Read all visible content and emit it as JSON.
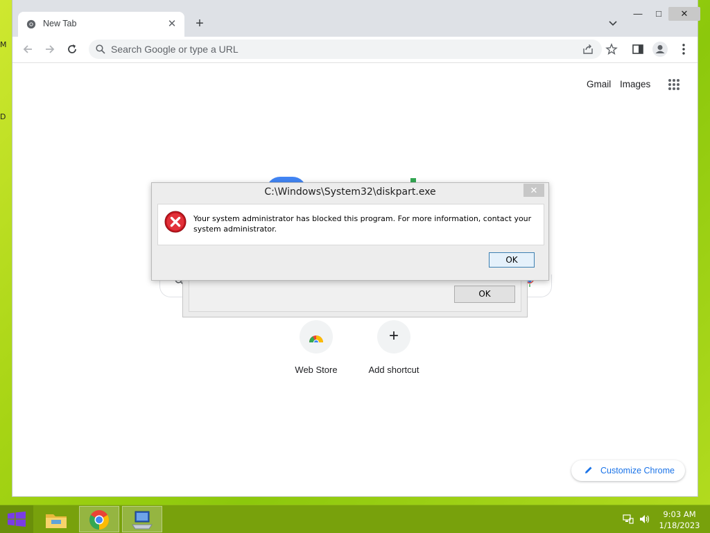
{
  "desktop": {
    "edge_letters": [
      "M",
      "D"
    ]
  },
  "browser": {
    "tab_title": "New Tab",
    "omnibox_placeholder": "Search Google or type a URL",
    "window_controls": {
      "minimize": "—",
      "maximize": "□",
      "close": "✕"
    }
  },
  "ntp": {
    "top_links": [
      "Gmail",
      "Images"
    ],
    "shortcuts": [
      {
        "label": "Web Store",
        "icon": "chrome-web-store-icon"
      },
      {
        "label": "Add shortcut",
        "icon": "plus-icon"
      }
    ],
    "customize_label": "Customize Chrome"
  },
  "back_dialog": {
    "ok_label": "OK"
  },
  "dialog": {
    "title": "C:\\Windows\\System32\\diskpart.exe",
    "message": "Your system administrator has blocked this program. For more information, contact your system administrator.",
    "ok_label": "OK",
    "close_glyph": "✕",
    "icon": "error-icon"
  },
  "taskbar": {
    "apps": [
      "start-icon",
      "file-explorer-icon",
      "chrome-icon",
      "remote-desktop-icon"
    ],
    "clock": {
      "time": "9:03 AM",
      "date": "1/18/2023"
    }
  },
  "colors": {
    "accent_blue": "#1a73e8",
    "taskbar": "#78a10c",
    "error_red": "#d11f2a"
  }
}
